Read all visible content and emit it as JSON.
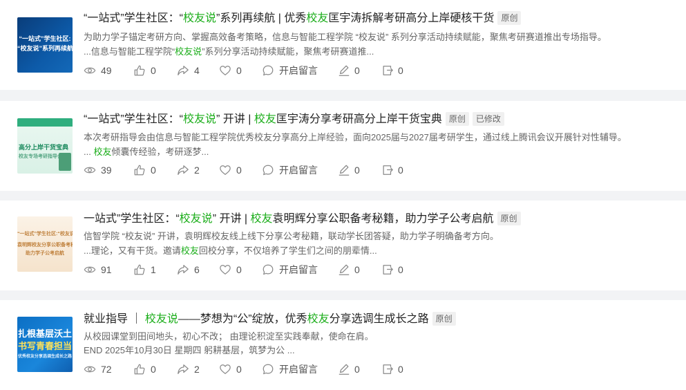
{
  "colors": {
    "highlight": "#1aad19",
    "icon": "#8a8a8a",
    "card_bg": "#ffffff",
    "page_bg": "#f2f3f5"
  },
  "icons": {
    "views": "eye-icon",
    "likes": "thumb-up-icon",
    "shares": "share-icon",
    "favorites": "heart-icon",
    "comments": "comment-icon",
    "edit": "pencil-icon",
    "export": "export-icon"
  },
  "comment_label": "开启留言",
  "articles": [
    {
      "thumb_lines": [
        "“一站式”学生社区:",
        "“校友说”系列再续航"
      ],
      "title": {
        "pre": "“一站式”学生社区：“",
        "hl1": "校友说",
        "mid": "”系列再续航 | 优秀",
        "hl2": "校友",
        "post": "匡宇涛拆解考研高分上岸硬核干货"
      },
      "tags": [
        "原创"
      ],
      "desc1": {
        "pre": "为助力学子锚定考研方向、掌握高效备考策略，信息与智能工程学院 “校友说” 系列分享活动持续赋能，聚焦考研赛道推出专场指导。",
        "hl": "",
        "post": ""
      },
      "desc2": {
        "pre": "...信息与智能工程学院“",
        "hl": "校友说",
        "post": "”系列分享活动持续赋能，聚焦考研赛道推..."
      },
      "stats": {
        "views": "49",
        "likes": "0",
        "shares": "4",
        "favorites": "0",
        "edit": "0",
        "export": "0"
      }
    },
    {
      "thumb_lines": [
        "高分上岸干货宝典",
        "校友专场考研指导会"
      ],
      "title": {
        "pre": "“一站式”学生社区：“",
        "hl1": "校友说",
        "mid": "” 开讲 | ",
        "hl2": "校友",
        "post": "匡宇涛分享考研高分上岸干货宝典"
      },
      "tags": [
        "原创",
        "已修改"
      ],
      "desc1": {
        "pre": "本次考研指导会由信息与智能工程学院优秀校友分享高分上岸经验，面向2025届与2027届考研学生，通过线上腾讯会议开展针对性辅导。",
        "hl": "",
        "post": ""
      },
      "desc2": {
        "pre": "... ",
        "hl": "校友",
        "post": "倾囊传经验，考研逐梦..."
      },
      "stats": {
        "views": "39",
        "likes": "0",
        "shares": "2",
        "favorites": "0",
        "edit": "0",
        "export": "0"
      }
    },
    {
      "thumb_lines": [
        "“一站式”学生社区:“校友说”开讲",
        "袁明辉校友分享公职备考秘籍",
        "助力学子公考启航"
      ],
      "title": {
        "pre": "一站式”学生社区：“",
        "hl1": "校友说",
        "mid": "” 开讲 | ",
        "hl2": "校友",
        "post": "袁明辉分享公职备考秘籍，助力学子公考启航"
      },
      "tags": [
        "原创"
      ],
      "desc1": {
        "pre": "信智学院 “校友说” 开讲，袁明辉校友线上线下分享公考秘籍，联动学长团答疑，助力学子明确备考方向。",
        "hl": "",
        "post": ""
      },
      "desc2": {
        "pre": "...理论，又有干货。邀请",
        "hl": "校友",
        "post": "回校分享，不仅培养了学生们之间的朋辈情..."
      },
      "stats": {
        "views": "91",
        "likes": "1",
        "shares": "6",
        "favorites": "0",
        "edit": "0",
        "export": "0"
      }
    },
    {
      "thumb_lines": [
        "扎根基层沃土",
        "书写青春担当",
        "优秀校友分享选调生成长之路"
      ],
      "title": {
        "pre": "就业指导 ｜ ",
        "hl1": "校友说",
        "mid": "——梦想为“公”绽放，优秀",
        "hl2": "校友",
        "post": "分享选调生成长之路"
      },
      "tags": [
        "原创"
      ],
      "desc1": {
        "pre": "从校园课堂到田间地头，初心不改； 由理论积淀至实践奉献，使命在肩。",
        "hl": "",
        "post": ""
      },
      "desc2": {
        "pre": "END 2025年10月30日 星期四 躬耕基层，筑梦为公 ...",
        "hl": "",
        "post": ""
      },
      "stats": {
        "views": "72",
        "likes": "0",
        "shares": "2",
        "favorites": "0",
        "edit": "0",
        "export": "0"
      }
    }
  ]
}
